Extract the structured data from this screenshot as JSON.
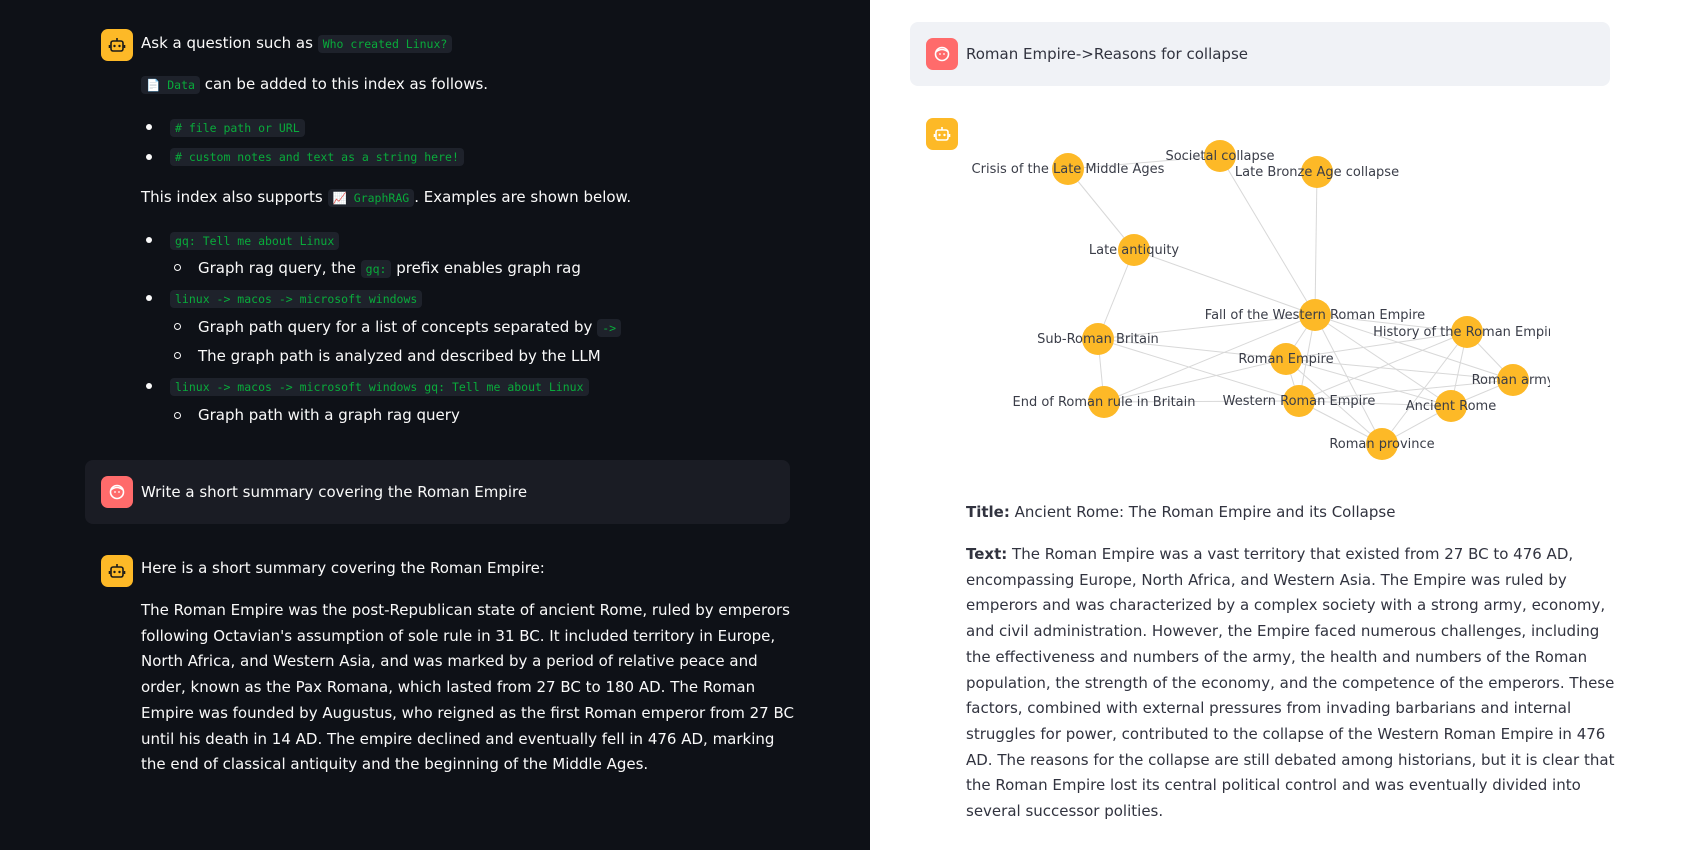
{
  "left": {
    "intro": {
      "ask_prefix": "Ask a question such as",
      "ask_code": "Who created Linux?",
      "data_code": "📄 Data",
      "data_suffix": "can be added to this index as follows.",
      "data_items": [
        "# file path or URL",
        "# custom notes and text as a string here!"
      ],
      "graphrag_prefix": "This index also supports",
      "graphrag_code": "📈 GraphRAG",
      "graphrag_suffix": ". Examples are shown below.",
      "example1_code": "gq: Tell me about Linux",
      "example1_sub_prefix": "Graph rag query, the",
      "example1_sub_code": "gq:",
      "example1_sub_suffix": "prefix enables graph rag",
      "example2_code": "linux -> macos -> microsoft windows",
      "example2_sub1_prefix": "Graph path query for a list of concepts separated by",
      "example2_sub1_code": "->",
      "example2_sub2": "The graph path is analyzed and described by the LLM",
      "example3_code": "linux -> macos -> microsoft windows gq: Tell me about Linux",
      "example3_sub": "Graph path with a graph rag query"
    },
    "user_message": "Write a short summary covering the Roman Empire",
    "reply_intro": "Here is a short summary covering the Roman Empire:",
    "reply_body": "The Roman Empire was the post-Republican state of ancient Rome, ruled by emperors following Octavian's assumption of sole rule in 31 BC. It included territory in Europe, North Africa, and Western Asia, and was marked by a period of relative peace and order, known as the Pax Romana, which lasted from 27 BC to 180 AD. The Roman Empire was founded by Augustus, who reigned as the first Roman emperor from 27 BC until his death in 14 AD. The empire declined and eventually fell in 476 AD, marking the end of classical antiquity and the beginning of the Middle Ages."
  },
  "right": {
    "user_message": "Roman Empire->Reasons for collapse",
    "graph": {
      "nodes": [
        "Crisis of the Late Middle Ages",
        "Societal collapse",
        "Late Bronze Age collapse",
        "Late antiquity",
        "Fall of the Western Roman Empire",
        "History of the Roman Empire",
        "Sub-Roman Britain",
        "Roman Empire",
        "Roman army",
        "End of Roman rule in Britain",
        "Western Roman Empire",
        "Ancient Rome",
        "Roman province"
      ]
    },
    "title_label": "Title:",
    "title_value": "Ancient Rome: The Roman Empire and its Collapse",
    "text_label": "Text:",
    "text_value": "The Roman Empire was a vast territory that existed from 27 BC to 476 AD, encompassing Europe, North Africa, and Western Asia. The Empire was ruled by emperors and was characterized by a complex society with a strong army, economy, and civil administration. However, the Empire faced numerous challenges, including the effectiveness and numbers of the army, the health and numbers of the Roman population, the strength of the economy, and the competence of the emperors. These factors, combined with external pressures from invading barbarians and internal struggles for power, contributed to the collapse of the Western Roman Empire in 476 AD. The reasons for the collapse are still debated among historians, but it is clear that the Roman Empire lost its central political control and was eventually divided into several successor polities."
  },
  "colors": {
    "dark_bg": "#0e1117",
    "bot_avatar": "#fdb927",
    "user_avatar": "#ff6b6b",
    "code_text": "#09ab3b",
    "graph_node": "#fdb927"
  },
  "icons": [
    "bot-icon",
    "user-icon"
  ]
}
